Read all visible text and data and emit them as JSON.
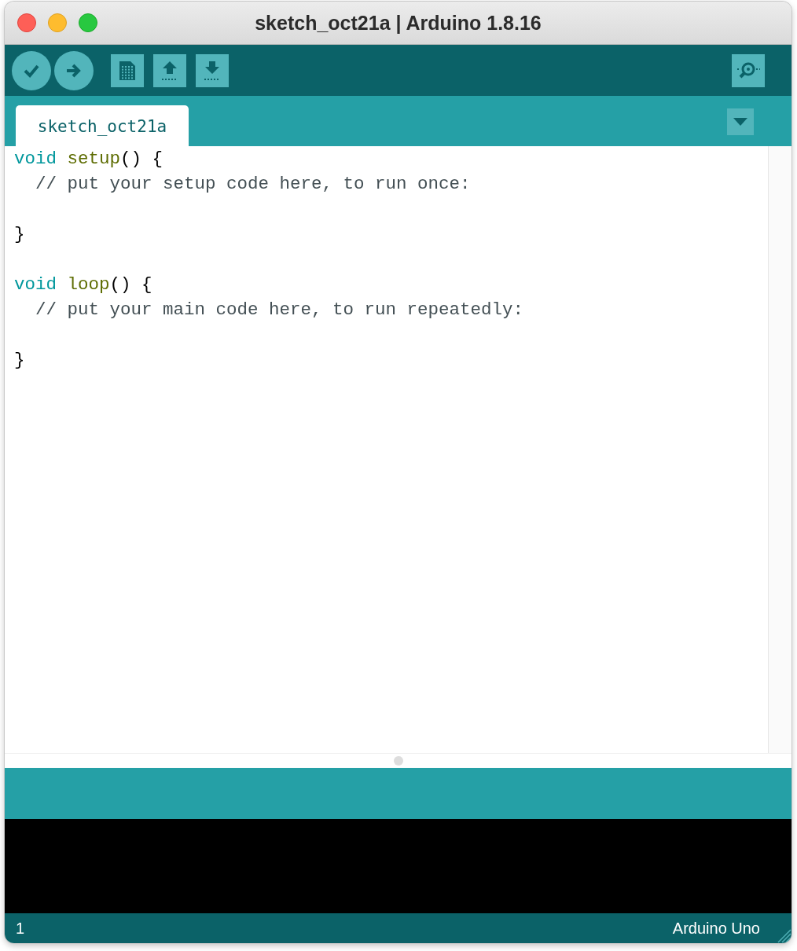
{
  "window": {
    "title": "sketch_oct21a | Arduino 1.8.16"
  },
  "tabs": [
    {
      "label": "sketch_oct21a",
      "selected": true
    }
  ],
  "editor": {
    "blocks": [
      {
        "lines": [
          {
            "tokens": [
              {
                "kind": "keyword",
                "text": "void"
              },
              {
                "kind": "function",
                "text": " setup"
              },
              {
                "kind": "plain",
                "text": "() {"
              }
            ]
          },
          {
            "tokens": [
              {
                "kind": "comment",
                "text": "  // put your setup code here, to run once:"
              }
            ]
          }
        ]
      },
      {
        "lines": [
          {
            "tokens": [
              {
                "kind": "plain",
                "text": "}"
              }
            ]
          }
        ]
      },
      {
        "lines": [
          {
            "tokens": [
              {
                "kind": "keyword",
                "text": "void"
              },
              {
                "kind": "function",
                "text": " loop"
              },
              {
                "kind": "plain",
                "text": "() {"
              }
            ]
          },
          {
            "tokens": [
              {
                "kind": "comment",
                "text": "  // put your main code here, to run repeatedly:"
              }
            ]
          }
        ]
      },
      {
        "lines": [
          {
            "tokens": [
              {
                "kind": "plain",
                "text": "}"
              }
            ]
          }
        ]
      }
    ]
  },
  "status_bar": {
    "line_number": "1",
    "board": "Arduino Uno"
  }
}
